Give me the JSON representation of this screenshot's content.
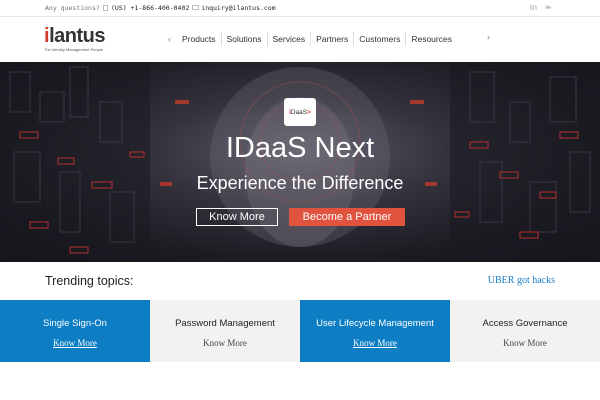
{
  "topbar": {
    "question": "Any questions?",
    "phone": "(US) +1-866-400-0402",
    "email": "inquiry@ilantus.com",
    "social": [
      {
        "icon": "linkedin-icon",
        "glyph": "in"
      },
      {
        "icon": "twitter-icon",
        "glyph": "❧"
      }
    ]
  },
  "logo": {
    "word_i": "i",
    "word_rest": "lantus",
    "tagline": "The Identity Management People"
  },
  "nav": {
    "prev_glyph": "‹",
    "next_glyph": "›",
    "items": [
      "Products",
      "Solutions",
      "Services",
      "Partners",
      "Customers",
      "Resources"
    ]
  },
  "hero": {
    "badge_i": "i",
    "badge_text": "DaaS",
    "badge_arrow": ">",
    "title": "IDaaS Next",
    "subtitle": "Experience the Difference",
    "primary_button": "Know More",
    "secondary_button": "Become a Partner"
  },
  "trending": {
    "label": "Trending topics:",
    "link": "UBER got hacks"
  },
  "tiles": [
    {
      "title": "Single Sign-On",
      "link": "Know More",
      "style": "blue"
    },
    {
      "title": "Password Management",
      "link": "Know More",
      "style": "grey"
    },
    {
      "title": "User Lifecycle Management",
      "link": "Know More",
      "style": "blue"
    },
    {
      "title": "Access Governance",
      "link": "Know More",
      "style": "grey"
    }
  ],
  "colors": {
    "brand_red": "#d43a2c",
    "accent_red": "#e0533f",
    "tile_blue": "#0d7ec3",
    "tile_grey": "#f2f2f2",
    "link_blue": "#1a7dc4"
  }
}
